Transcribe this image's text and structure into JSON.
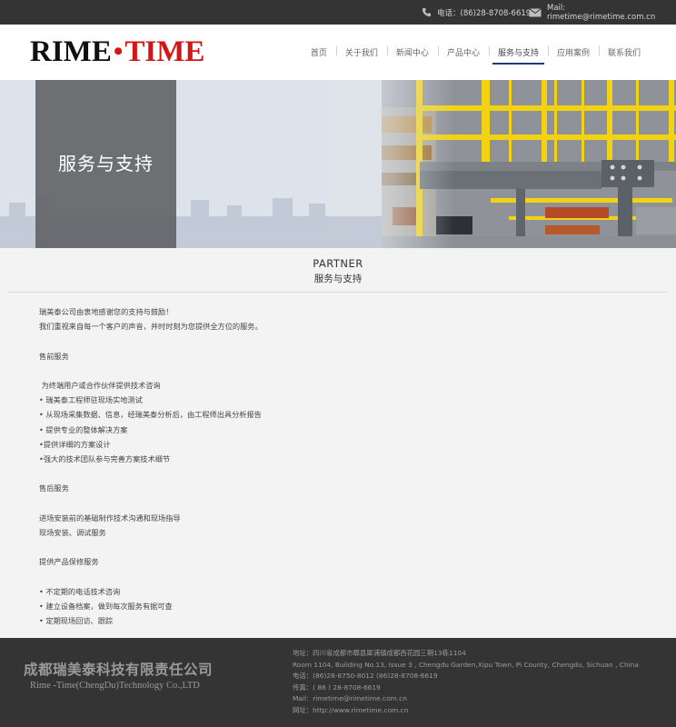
{
  "topbar": {
    "phone": "电话：(86)28-8708-6619",
    "mail": "Mail:  rimetime@rimetime.com.cn"
  },
  "header": {
    "logo": {
      "left": "RIME",
      "dot": "•",
      "right": "TIME"
    },
    "nav": [
      {
        "label": "首页"
      },
      {
        "label": "关于我们"
      },
      {
        "label": "新闻中心"
      },
      {
        "label": "产品中心"
      },
      {
        "label": "服务与支持",
        "active": true
      },
      {
        "label": "应用案例"
      },
      {
        "label": "联系我们"
      }
    ]
  },
  "banner": {
    "title": "服务与支持"
  },
  "section": {
    "title_en": "PARTNER",
    "title_cn": "服务与支持"
  },
  "content": {
    "lines": [
      "瑞美泰公司由衷地感谢您的支持与鼓励！",
      "我们重视来自每一个客户的声音，并时时刻为您提供全方位的服务。",
      "",
      "售前服务",
      "",
      " 为终端用户或合作伙伴提供技术咨询",
      "• 瑞美泰工程师驻现场实地测试",
      "• 从现场采集数据、信息，经瑞美泰分析后，由工程师出具分析报告",
      "• 提供专业的整体解决方案",
      "•提供详细的方案设计",
      "•强大的技术团队参与完善方案技术细节",
      "",
      "售后服务",
      "",
      "进场安装前的基础制作技术沟通和现场指导",
      "现场安装、调试服务",
      "",
      "提供产品保修服务",
      "",
      "• 不定期的电话技术咨询",
      "• 建立设备档案，做到每次服务有据可查",
      "• 定期现场回访、跟踪"
    ]
  },
  "footer": {
    "company_cn": "成都瑞美泰科技有限责任公司",
    "company_en": "Rime -Time(ChengDu)Technology Co.,LTD",
    "info": [
      "地址：四川省成都市郫县犀浦镇成都西花园三期13栋1104",
      "Room 1104, Building No.13, Issue 3 , Chengdu Garden,Xipu Town, Pi County, Chengdu, Sichuan , China",
      "电话：(86)28-8750-8012 (86)28-8708-6619",
      "传真：( 86 ) 28-8708-6619",
      "Mail:  rimetime@rimetime.com.cn",
      "网址：http://www.rimetime.com.cn"
    ]
  },
  "colors": {
    "topbar_bg": "#343434",
    "logo_red": "#d21616",
    "nav_active_underline": "#1d3d74",
    "footer_bg": "#343434",
    "page_bg": "#f3f3f3"
  }
}
